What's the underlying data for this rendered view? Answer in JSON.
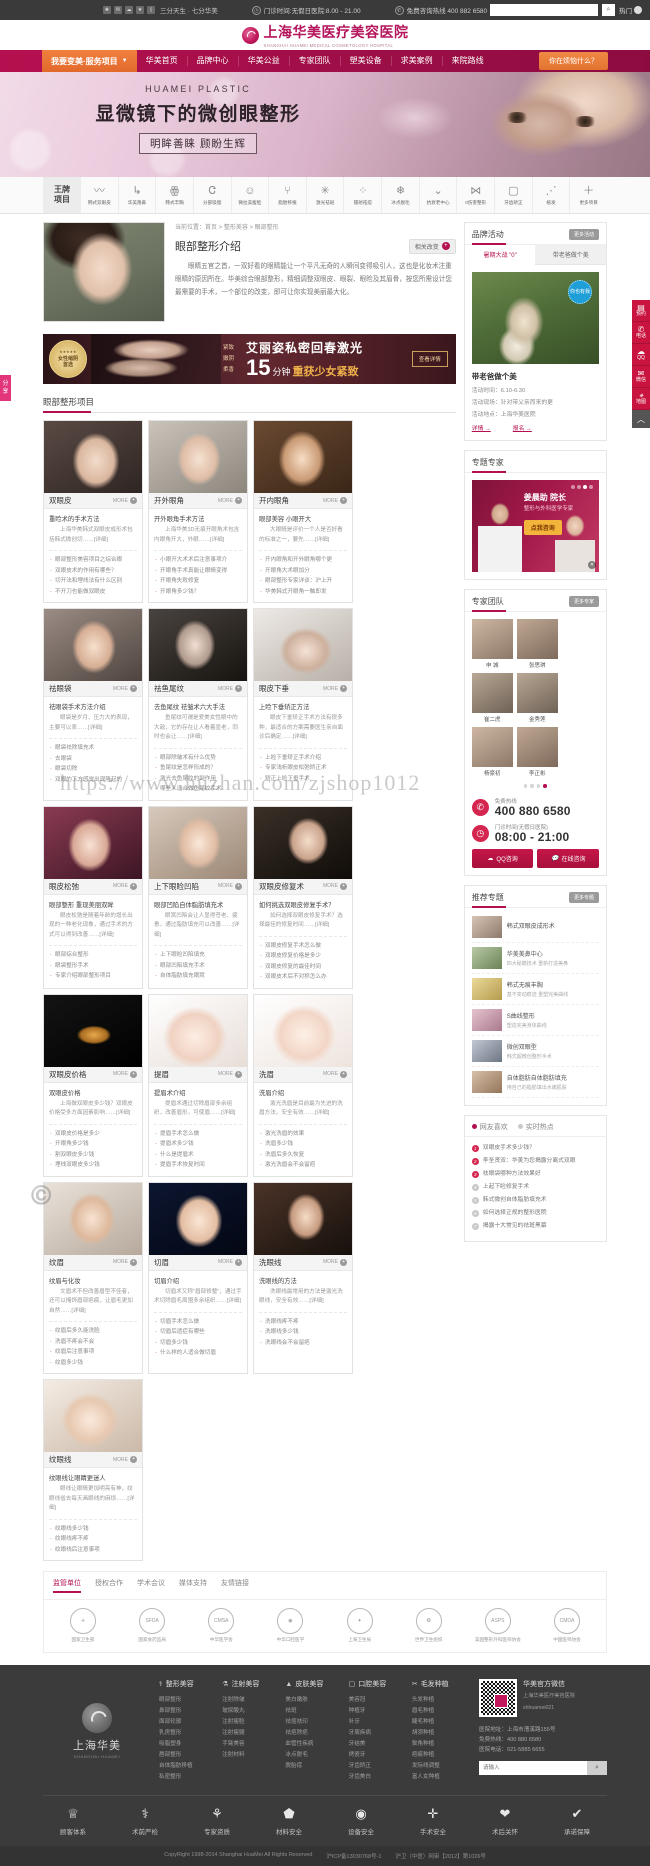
{
  "topbar": {
    "social_icons": [
      "weibo-icon",
      "wechat-icon",
      "qq-icon",
      "star-icon",
      "mobile-icon"
    ],
    "slogan": "三分天生 · 七分华美",
    "hours_icon": "clock-icon",
    "hours": "门诊时间:无假日医院:8.00 - 21.00",
    "phone_icon": "phone-icon",
    "phone": "免费咨询热线 400 882 6580",
    "search_placeholder": "",
    "search_icon": "search-icon",
    "login": "热门",
    "gear_icon": "gear-icon"
  },
  "logo": {
    "cn": "上海华美医疗美容医院",
    "en": "SHANGHAI HUAMEI MEDICAL COSMETOLOGY HOSPITAL",
    "mark": "huamei-logo-icon"
  },
  "nav": {
    "dropdown": "我要变美·服务项目",
    "chevron": "chevron-down-icon",
    "items": [
      "华美首页",
      "品牌中心",
      "华美公益",
      "专家团队",
      "塑美设备",
      "求美案例",
      "来院路线"
    ],
    "cta": "你在烦恼什么？"
  },
  "banner": {
    "en": "HUAMEI PLASTIC",
    "cn": "显微镜下的微创眼整形",
    "sub": "明眸善睐  顾盼生辉"
  },
  "iconnav": {
    "badge_l1": "王牌",
    "badge_l2": "项目",
    "items": [
      {
        "label": "韩式双眼皮",
        "icon": "eyelid-icon"
      },
      {
        "label": "华美隆鼻",
        "icon": "nose-icon"
      },
      {
        "label": "韩式丰胸",
        "icon": "breast-icon"
      },
      {
        "label": "分部吸脂",
        "icon": "liposuction-icon"
      },
      {
        "label": "微拉美瘦脸",
        "icon": "face-icon"
      },
      {
        "label": "脂肪移植",
        "icon": "fat-graft-icon"
      },
      {
        "label": "激光祛斑",
        "icon": "laser-icon"
      },
      {
        "label": "镭射祛痘",
        "icon": "acne-icon"
      },
      {
        "label": "冰点脱毛",
        "icon": "hair-removal-icon"
      },
      {
        "label": "抗衰老中心",
        "icon": "antiaging-icon"
      },
      {
        "label": "0伤害整形",
        "icon": "zero-harm-icon"
      },
      {
        "label": "牙齿矫正",
        "icon": "tooth-icon"
      },
      {
        "label": "植发",
        "icon": "hair-transplant-icon"
      },
      {
        "label": "更多项目",
        "icon": "plus-icon"
      }
    ]
  },
  "article": {
    "breadcrumb": "当前位置：首页 > 整形美容 > 眼部整形",
    "title": "眼部整形介绍",
    "related_btn": "相关改变",
    "related_icon": "plus-circle-icon",
    "paragraph": "眼睛五官之首，一双好看的眼睛能让一个平凡无奇的人瞬间变得吸引人，这也是化妆术注重眼睛的原因所在。华美综合眼部整形，精细调整双眼皮、眼裂、眼睑及其眉骨，按您所需设计您最需要的手术，一个部位的改变，即可让你实现美丽最大化。"
  },
  "promo": {
    "seal_stars": "★★★★★",
    "seal_l1": "女性缩阴",
    "seal_l2": "首选",
    "cols": [
      "紧致",
      "嫩阴",
      "柔香"
    ],
    "title": "艾丽姿私密回春激光",
    "num": "15",
    "unit": "分钟",
    "rest": "重获少女紧致",
    "btn": "查看详情"
  },
  "section": {
    "title": "眼部整形项目"
  },
  "cards": [
    {
      "title": "双眼皮",
      "more": "MORE",
      "head": "重睑术的手术方法",
      "text": "上海华美韩式双眼皮成形术包括韩式微创切……[详细]",
      "links": [
        "眼部整形美容项目之综合眼",
        "双眼皮术的作用有哪些？",
        "切开法和埋线法有什么区别",
        "不开刀也能做双眼皮"
      ]
    },
    {
      "title": "开外眼角",
      "more": "MORE",
      "head": "开外眼角手术方法",
      "text": "上海华美3D无痕开眼角术包含内眼角开大，外眼……[详细]",
      "links": [
        "小眼开大术术后注意事项介",
        "开眼角手术真能让眼睛变得",
        "开眼角失败修复",
        "开眼角多少钱？"
      ]
    },
    {
      "title": "开内眼角",
      "more": "MORE",
      "head": "眼部美容 小眼开大",
      "text": "大眼睛是评价一个人是否好看的标准之一，要先……[详细]",
      "links": [
        "开内眼角和开外眼角哪个更",
        "开眼角大术眼加分",
        "眼部整形专家详谈：沪上开",
        "华美韩式开眼角一触即发"
      ]
    },
    {
      "title": "祛眼袋",
      "more": "MORE",
      "head": "祛眼袋手术方法介绍",
      "text": "眼袋是岁月、压力大的表现，主要可以表……[详细]",
      "links": [
        "眼袋祛除填充术",
        "去眼袋",
        "眼袋切除",
        "双眼的下方感觉出现隆起的"
      ]
    },
    {
      "title": "祛鱼尾纹",
      "more": "MORE",
      "head": "去鱼尾纹 祛皱术六大手法",
      "text": "鱼尾纹可谓是爱美女性眼中的大敌，它的存在让人看着显老，同时也会让……[详细]",
      "links": [
        "眼部除皱术有什么优势",
        "鱼尾纹是怎样形成的？",
        "激光去鱼尾纹的副作用",
        "哪些人适合做鱼尾纹手术"
      ]
    },
    {
      "title": "眼皮下垂",
      "more": "MORE",
      "head": "上睑下垂矫正方法",
      "text": "眼皮下垂矫正手术方法有很多种，最适合的方案需要医生亲自面诊后确定……[详细]",
      "links": [
        "上睑下垂矫正手术介绍",
        "专家浅析眼皮松弛矫正术",
        "矫正上睑下垂手术"
      ]
    },
    {
      "title": "眼皮松弛",
      "more": "MORE",
      "head": "眼部整形 重现美丽双眸",
      "text": "眼皮松弛是随着年龄的增长出现的一种老化现象，通过手术的方式可以得到改善……[详细]",
      "links": [
        "眼部综合整形",
        "眼袋整形手术",
        "专家介绍眼部整形项目"
      ]
    },
    {
      "title": "上下眼睑凹陷",
      "more": "MORE",
      "head": "眼部凹陷自体脂肪填充术",
      "text": "眼窝凹陷会让人显得苍老、疲惫，通过脂肪填充可以改善……[详细]",
      "links": [
        "上下眼睑凹陷填充",
        "眼部凹陷填充手术",
        "自体脂肪填充眼窝"
      ]
    },
    {
      "title": "双眼皮修复术",
      "more": "MORE",
      "head": "如何挑选双眼皮修复手术？",
      "text": "如何选择双眼皮修复手术？选择最佳的修复时间……[详细]",
      "links": [
        "双眼皮修复手术怎么做",
        "双眼皮修复价格是多少",
        "双眼皮修复的最佳时间",
        "双眼皮术后不对称怎么办"
      ]
    },
    {
      "title": "双眼皮价格",
      "more": "MORE",
      "head": "双眼皮价格",
      "text": "上海做双眼皮多少钱？双眼皮价格受多方面因素影响……[详细]",
      "links": [
        "双眼皮价格是多少",
        "开眼角多少钱",
        "割双眼皮多少钱",
        "埋线双眼皮多少钱"
      ]
    },
    {
      "title": "提眉",
      "more": "MORE",
      "head": "提眉术介绍",
      "text": "提眉术通过切除眉部多余组织，改善眉形，可使眉……[详细]",
      "links": [
        "提眉手术怎么做",
        "提眉术多少钱",
        "什么是提眉术",
        "提眉手术恢复时间"
      ]
    },
    {
      "title": "洗眉",
      "more": "MORE",
      "head": "洗眉介绍",
      "text": "激光洗眉是目前最为先进的洗眉方法，安全有效……[详细]",
      "links": [
        "激光洗眉的效果",
        "洗眉多少钱",
        "洗眉后多久恢复",
        "激光洗眉会不会留疤"
      ]
    },
    {
      "title": "纹眉",
      "more": "MORE",
      "head": "纹眉与化妆",
      "text": "文眉术不但改善眉型不佳者，还可以掩饰眉部疤痕，让眉毛更加自然……[详细]",
      "links": [
        "纹眉后多久能洗脸",
        "洗眉不疼会不会",
        "纹眉后注意事项",
        "纹眉多少钱"
      ]
    },
    {
      "title": "切眉",
      "more": "MORE",
      "head": "切眉介绍",
      "text": "切眉术又称\"眉部修整\"，通过手术切除眉毛周围多余组织……[详细]",
      "links": [
        "切眉手术怎么做",
        "切眉后遗症有哪些",
        "切眉多少钱",
        "什么样的人适合做切眉"
      ]
    },
    {
      "title": "洗眼线",
      "more": "MORE",
      "head": "洗眼线的方法",
      "text": "洗眼线最常用的方法是激光洗眼线，安全有效……[详细]",
      "links": [
        "洗眼线疼不疼",
        "洗眼线多少钱",
        "洗眼线会不会留疤"
      ]
    },
    {
      "title": "纹眼线",
      "more": "MORE",
      "head": "纹眼线让眼睛更迷人",
      "text": "眼线让眼睛更加明亮有神，纹眼线省去每天画眼线的麻烦……[详细]",
      "links": [
        "纹眼线多少钱",
        "纹眼线疼不疼",
        "纹眼线后注意事项"
      ]
    }
  ],
  "sidebar": {
    "brand_activity": {
      "title": "品牌活动",
      "more": "更多活动",
      "tabs": [
        {
          "label": "暑期大战 \"0\"",
          "active": true
        },
        {
          "label": "带老爸做个美",
          "active": false
        }
      ],
      "badge": "你也有我",
      "act_title": "带老爸做个美",
      "lines": [
        "活动时间：6.10-6.30",
        "活动现场：针对带父亲而来的更",
        "活动地点：上海华美医院"
      ],
      "links": [
        "详情 →",
        "报名 →"
      ]
    },
    "zhuanti": {
      "title": "专题专家",
      "name": "姜晨助 院长",
      "role": "整形与外科医学专家",
      "badge": "6月",
      "button": "点我咨询",
      "close_icon": "close-icon"
    },
    "experts": {
      "title": "专家团队",
      "more": "更多专家",
      "list": [
        "申 城",
        "张思琪",
        "崔二虎",
        "金秀莲",
        "杨豪初",
        "李正彬"
      ]
    },
    "contact": {
      "hotline_icon": "phone-icon",
      "hotline_label": "免费热线",
      "hotline": "400 880 6580",
      "hours_icon": "clock-icon",
      "hours_label": "门诊时间(无假日医院)",
      "hours": "08:00 - 21:00",
      "btn_qq": "QQ咨询",
      "btn_online": "在线咨询",
      "qq_icon": "qq-icon",
      "chat_icon": "chat-icon"
    },
    "recommend": {
      "title": "推荐专题",
      "more": "更多专题",
      "items": [
        {
          "t": "韩式双眼皮成形术",
          "s": ""
        },
        {
          "t": "华美美鼻中心",
          "s": "四大秘籍技术 重新打造美鼻"
        },
        {
          "t": "韩式无痕丰胸",
          "s": "基不变动痕迹 重塑完美曲线"
        },
        {
          "t": "S曲线整形",
          "s": "塑造完美身体曲线"
        },
        {
          "t": "微创双眼型",
          "s": "韩式超微创整形手术"
        },
        {
          "t": "自体脂肪自体脂肪填充",
          "s": "用自己的脂肪填出水嫩肌肤"
        }
      ]
    },
    "hot": {
      "tabs": [
        {
          "label": "网友喜欢",
          "active": true
        },
        {
          "label": "实时热点",
          "active": false
        }
      ],
      "items": [
        "双眼皮手术多少钱？",
        "李圣贤双：华美为您揭露分离式双眼",
        "祛眼袋哪种方法效果好",
        "上起下睑修复手术",
        "韩式微创自体脂肪填充术",
        "如何选择正规的整形医院",
        "揭露十大常见的祛斑黑幕"
      ]
    }
  },
  "partners": {
    "tabs": [
      {
        "label": "监管单位",
        "active": true
      },
      {
        "label": "授权合作",
        "active": false
      },
      {
        "label": "学术会议",
        "active": false
      },
      {
        "label": "媒体支持",
        "active": false
      },
      {
        "label": "友情链接",
        "active": false
      }
    ],
    "items": [
      {
        "name": "国家卫生部",
        "seal": "seal-icon"
      },
      {
        "name": "国家食药监局",
        "seal": "sfda-icon"
      },
      {
        "name": "中华医学会",
        "seal": "cmsa-icon"
      },
      {
        "name": "中华口腔医学",
        "seal": "cas-icon"
      },
      {
        "name": "上海卫生局",
        "seal": "shanghai-icon"
      },
      {
        "name": "世界卫生组织",
        "seal": "who-icon"
      },
      {
        "name": "美国整形外科医师协会",
        "seal": "asps-icon"
      },
      {
        "name": "中国医师协会",
        "seal": "cmda-icon"
      }
    ]
  },
  "footer": {
    "logo_cn": "上海华美",
    "logo_en": "SHANGHAI HUAMEI",
    "columns": [
      {
        "head": "整形美容",
        "icon": "scalpel-icon",
        "links": [
          "眼部整形",
          "鼻部整形",
          "面部轮廓",
          "乳房整形",
          "吸脂塑身",
          "唇部整形",
          "自体脂肪移植",
          "私密整形"
        ]
      },
      {
        "head": "注射美容",
        "icon": "syringe-icon",
        "links": [
          "注射除皱",
          "玻尿酸丸",
          "注射瘦脸",
          "注射瘦腿",
          "手臂美容",
          "注射材料"
        ]
      },
      {
        "head": "皮肤美容",
        "icon": "skin-icon",
        "links": [
          "美白嫩肤",
          "祛斑",
          "祛痘祛印",
          "祛疤除疤",
          "血管性疾病",
          "冰点脱毛",
          "脱胎痣"
        ]
      },
      {
        "head": "口腔美容",
        "icon": "tooth-icon",
        "links": [
          "美容冠",
          "种植牙",
          "补牙",
          "牙周疾病",
          "牙结美",
          "烤瓷牙",
          "牙齿矫正",
          "牙齿美白"
        ]
      },
      {
        "head": "毛发种植",
        "icon": "hair-icon",
        "links": [
          "头发种植",
          "眉毛种植",
          "睫毛种植",
          "胡须种植",
          "鬓角种植",
          "疤痕种植",
          "发际线调整",
          "富人女种植"
        ]
      }
    ],
    "wechat": {
      "title": "华美官方微信",
      "line1": "上海华美医疗美容医院",
      "line2": "shhuamei021",
      "qr_icon": "qr-code-icon"
    },
    "info": [
      "医院地址：上海市漕溪路155号",
      "免费热线：400 880 6580",
      "医院电话：021-5885 6655"
    ],
    "search_placeholder": "请输入",
    "search_icon": "search-icon",
    "features": [
      {
        "label": "顾客体系",
        "icon": "crown-icon"
      },
      {
        "label": "术前严检",
        "icon": "stethoscope-icon"
      },
      {
        "label": "专家资质",
        "icon": "doctor-icon"
      },
      {
        "label": "材料安全",
        "icon": "shield-icon"
      },
      {
        "label": "设备安全",
        "icon": "device-icon"
      },
      {
        "label": "手术安全",
        "icon": "pulse-icon"
      },
      {
        "label": "术后关怀",
        "icon": "heart-icon"
      },
      {
        "label": "承诺保障",
        "icon": "ribbon-icon"
      }
    ],
    "copyright": "CopyRight 1998-2014 Shanghai HuaMei All Rights Reserved",
    "icp": "沪ICP备13030768号-1",
    "license": "沪卫（中医）网审【2012】第1026号"
  },
  "floating": {
    "right": [
      {
        "label": "预约",
        "icon": "calendar-icon"
      },
      {
        "label": "电话",
        "icon": "phone-icon"
      },
      {
        "label": "QQ",
        "icon": "qq-icon"
      },
      {
        "label": "微信",
        "icon": "wechat-icon"
      },
      {
        "label": "地图",
        "icon": "map-icon"
      }
    ],
    "back_to_top_icon": "arrow-up-icon",
    "left_share": "分享"
  },
  "watermark": {
    "url": "https://www.huzhan.com/zjshop1012"
  }
}
